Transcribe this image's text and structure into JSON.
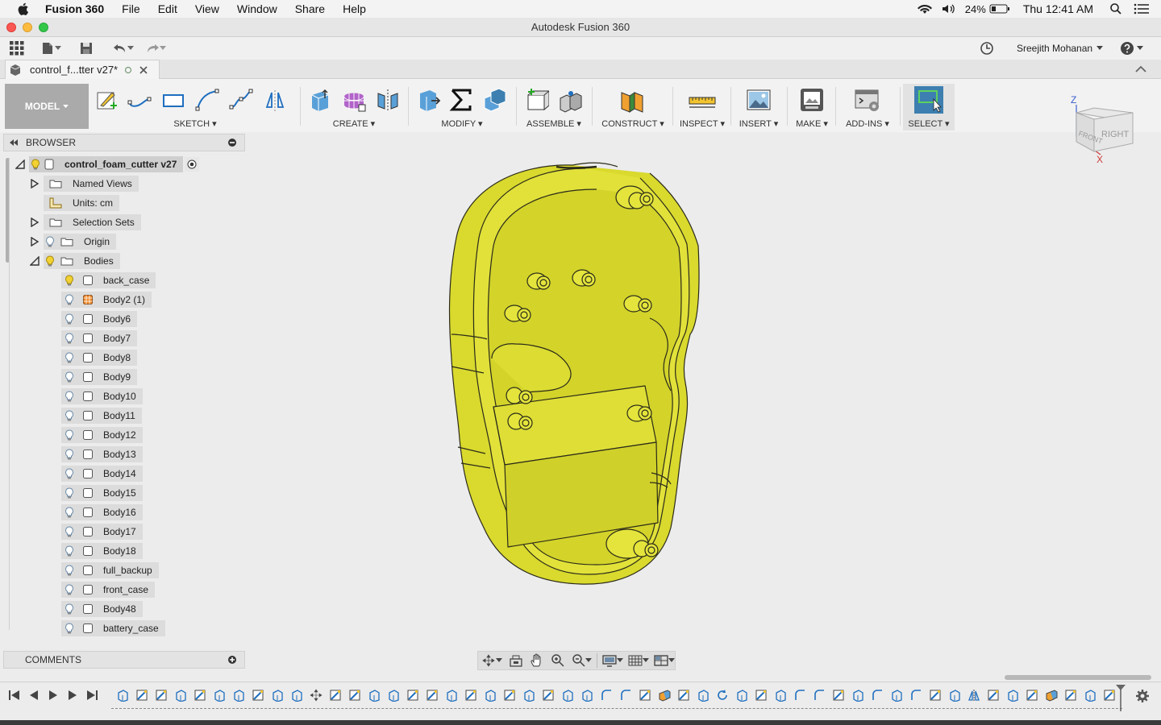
{
  "menubar": {
    "app_name": "Fusion 360",
    "items": [
      "File",
      "Edit",
      "View",
      "Window",
      "Share",
      "Help"
    ],
    "battery": "24%",
    "clock": "Thu 12:41 AM"
  },
  "window": {
    "title": "Autodesk Fusion 360"
  },
  "qat": {
    "user": "Sreejith Mohanan"
  },
  "doc_tab": {
    "label": "control_f...tter v27*"
  },
  "ribbon": {
    "workspace": "MODEL",
    "groups": [
      "SKETCH",
      "CREATE",
      "MODIFY",
      "ASSEMBLE",
      "CONSTRUCT",
      "INSPECT",
      "INSERT",
      "MAKE",
      "ADD-INS",
      "SELECT"
    ]
  },
  "browser": {
    "title": "BROWSER",
    "root": "control_foam_cutter v27",
    "named_views": "Named Views",
    "units": "Units: cm",
    "selection_sets": "Selection Sets",
    "origin": "Origin",
    "bodies_folder": "Bodies",
    "bodies": [
      "back_case",
      "Body2 (1)",
      "Body6",
      "Body7",
      "Body8",
      "Body9",
      "Body10",
      "Body11",
      "Body12",
      "Body13",
      "Body14",
      "Body15",
      "Body16",
      "Body17",
      "Body18",
      "full_backup",
      "front_case",
      "Body48",
      "battery_case"
    ]
  },
  "viewcube": {
    "top_label": "FRONT",
    "right_label": "RIGHT",
    "axis_z": "Z",
    "axis_x": "X"
  },
  "comments": {
    "title": "COMMENTS"
  },
  "colors": {
    "body": "#d7d72e",
    "select_accent": "#3d7fb0"
  }
}
